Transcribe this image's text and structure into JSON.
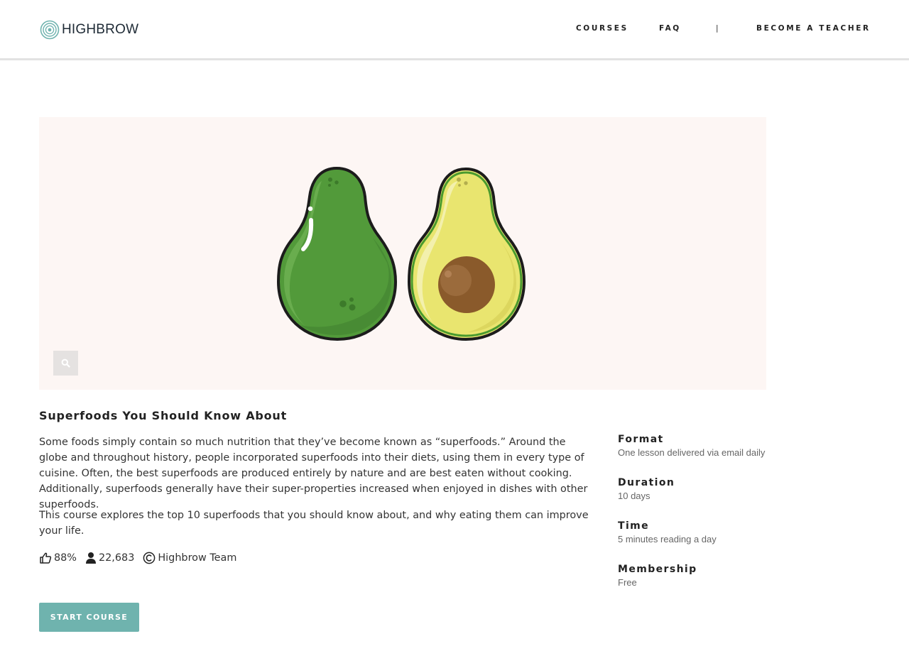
{
  "brand": {
    "name": "HIGHBROW",
    "logo_icon": "concentric-circles-logo",
    "accent_color": "#6fb3ae"
  },
  "nav": {
    "courses": "COURSES",
    "faq": "FAQ",
    "separator": "|",
    "become_teacher": "BECOME A TEACHER"
  },
  "hero": {
    "image_subject": "avocado-illustration",
    "zoom_icon": "search-icon"
  },
  "course": {
    "title": "Superfoods You Should Know About",
    "description_1": "Some foods simply contain so much nutrition that they’ve become known as “superfoods.” Around the globe and throughout history, people incorporated superfoods into their diets, using them in every type of cuisine. Often, the best superfoods are produced entirely by nature and are best eaten without cooking. Additionally, superfoods generally have their super-properties increased when enjoyed in dishes with other superfoods.",
    "description_2": "This course explores the top 10 superfoods that you should know about, and why eating them can improve your life.",
    "stats": {
      "rating": "88%",
      "rating_icon": "thumbs-up-icon",
      "students": "22,683",
      "students_icon": "user-icon",
      "author": "Highbrow Team",
      "author_icon": "copyright-icon"
    },
    "start_label": "START COURSE"
  },
  "info": {
    "format_label": "Format",
    "format_value": "One lesson delivered via email daily",
    "duration_label": "Duration",
    "duration_value": "10 days",
    "time_label": "Time",
    "time_value": "5 minutes reading a day",
    "membership_label": "Membership",
    "membership_value": "Free"
  }
}
